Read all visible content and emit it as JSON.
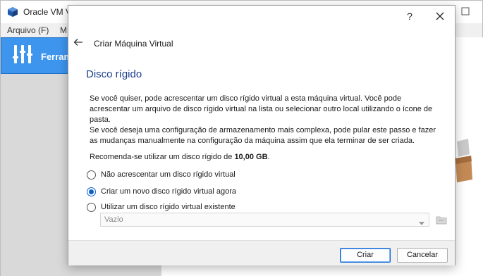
{
  "main_window": {
    "title": "Oracle VM V",
    "menu": [
      "Arquivo (F)",
      "M"
    ],
    "tools_label": "Ferram"
  },
  "dialog": {
    "help_label": "?",
    "header_title": "Criar Máquina Virtual",
    "section_title": "Disco rígido",
    "paragraph1": "Se você quiser, pode acrescentar um disco rígido virtual a esta máquina virtual. Você pode acrescentar um arquivo de disco rígido virtual na lista ou selecionar outro local utilizando o ícone de pasta.",
    "paragraph2": "Se você deseja uma configuração de armazenamento mais complexa, pode pular este passo e fazer as mudanças manualmente na configuração da máquina assim que ela terminar de ser criada.",
    "recommend_prefix": "Recomenda-se utilizar um disco rígido de ",
    "recommend_size": "10,00 GB",
    "recommend_suffix": ".",
    "options": [
      {
        "label": "Não acrescentar um disco rígido virtual",
        "checked": false
      },
      {
        "label": "Criar um novo disco rígido virtual agora",
        "checked": true
      },
      {
        "label": "Utilizar um disco rígido virtual existente",
        "checked": false
      }
    ],
    "existing_disk_value": "Vazio",
    "buttons": {
      "create": "Criar",
      "cancel": "Cancelar"
    }
  },
  "colors": {
    "accent": "#0a5fc9",
    "section_title": "#1c3f8a",
    "tools_highlight": "#3e95ee"
  },
  "icons": [
    "virtualbox-icon",
    "maximize-icon",
    "tools-icon",
    "close-icon",
    "back-arrow-icon",
    "dropdown-arrow-icon",
    "folder-icon"
  ]
}
